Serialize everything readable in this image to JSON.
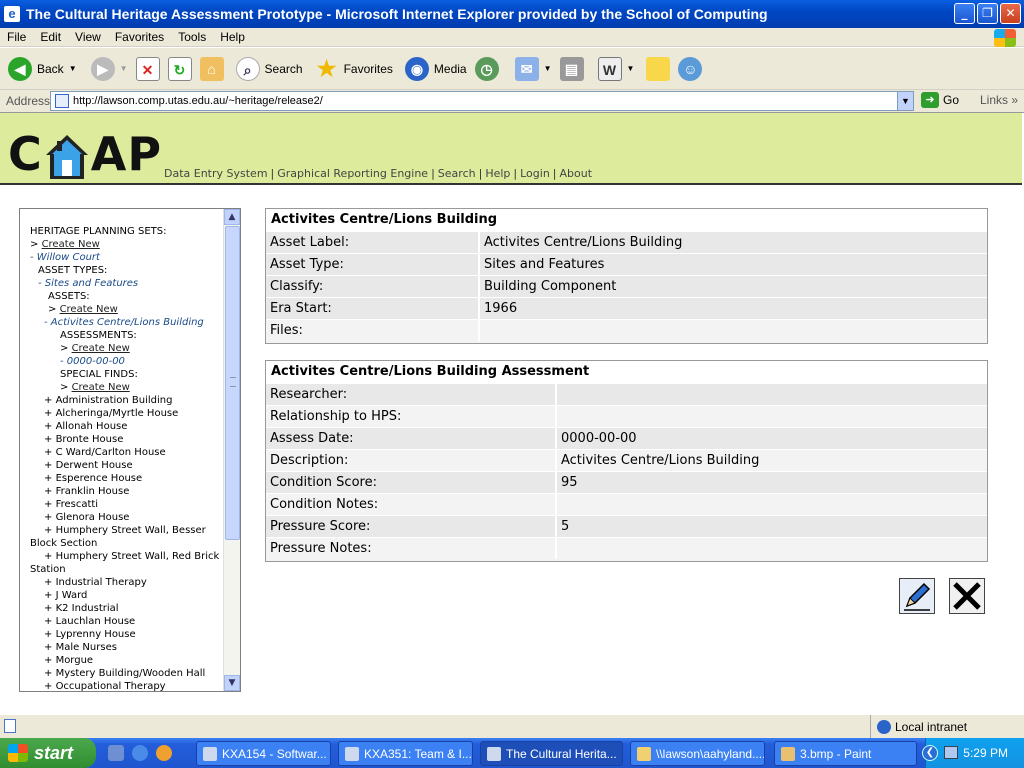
{
  "window": {
    "title": "The Cultural Heritage Assessment Prototype - Microsoft Internet Explorer provided by the School of Computing"
  },
  "menu": [
    "File",
    "Edit",
    "View",
    "Favorites",
    "Tools",
    "Help"
  ],
  "toolbar": {
    "back": "Back",
    "search": "Search",
    "favorites": "Favorites",
    "media": "Media"
  },
  "address": {
    "label": "Address",
    "url": "http://lawson.comp.utas.edu.au/~heritage/release2/",
    "go": "Go",
    "links": "Links"
  },
  "site": {
    "logo_left": "C",
    "logo_right": "AP",
    "nav": [
      "Data Entry System",
      "Graphical Reporting Engine",
      "Search",
      "Help",
      "Login",
      "About"
    ]
  },
  "sidebar": {
    "heading": "HERITAGE PLANNING SETS:",
    "create_new": "Create New",
    "current_set": "Willow Court",
    "asset_types_label": "ASSET TYPES:",
    "current_type": "Sites and Features",
    "assets_label": "ASSETS:",
    "current_asset": "Activites Centre/Lions Building",
    "assessments_label": "ASSESSMENTS:",
    "current_assessment": "0000-00-00",
    "special_finds_label": "SPECIAL FINDS:",
    "assets": [
      "Administration Building",
      "Alcheringa/Myrtle House",
      "Allonah House",
      "Bronte House",
      "C Ward/Carlton House",
      "Derwent House",
      "Esperence House",
      "Franklin House",
      "Frescatti",
      "Glenora House",
      "Humphery Street Wall, Besser",
      "Block Section",
      "Humphery Street Wall, Red Brick",
      "Station",
      "Industrial Therapy",
      "J Ward",
      "K2 Industrial",
      "Lauchlan House",
      "Lyprenny House",
      "Male Nurses",
      "Morgue",
      "Mystery Building/Wooden Hall",
      "Occupational Therapy"
    ]
  },
  "asset_panel": {
    "title": "Activites Centre/Lions Building",
    "rows": [
      {
        "label": "Asset Label:",
        "value": "Activites Centre/Lions Building"
      },
      {
        "label": "Asset Type:",
        "value": "Sites and Features"
      },
      {
        "label": "Classify:",
        "value": "Building Component"
      },
      {
        "label": "Era Start:",
        "value": "1966"
      },
      {
        "label": "Files:",
        "value": ""
      }
    ]
  },
  "assessment_panel": {
    "title": "Activites Centre/Lions Building Assessment",
    "rows": [
      {
        "label": "Researcher:",
        "value": ""
      },
      {
        "label": "Relationship to HPS:",
        "value": ""
      },
      {
        "label": "Assess Date:",
        "value": "0000-00-00"
      },
      {
        "label": "Description:",
        "value": "Activites Centre/Lions Building"
      },
      {
        "label": "Condition Score:",
        "value": "95"
      },
      {
        "label": "Condition Notes:",
        "value": ""
      },
      {
        "label": "Pressure Score:",
        "value": "5"
      },
      {
        "label": "Pressure Notes:",
        "value": ""
      }
    ]
  },
  "status": {
    "zone": "Local intranet"
  },
  "taskbar": {
    "start": "start",
    "tasks": [
      "KXA154 - Softwar...",
      "KXA351: Team & I...",
      "The Cultural Herita...",
      "\\\\lawson\\aahyland....",
      "3.bmp - Paint"
    ],
    "clock": "5:29 PM"
  }
}
